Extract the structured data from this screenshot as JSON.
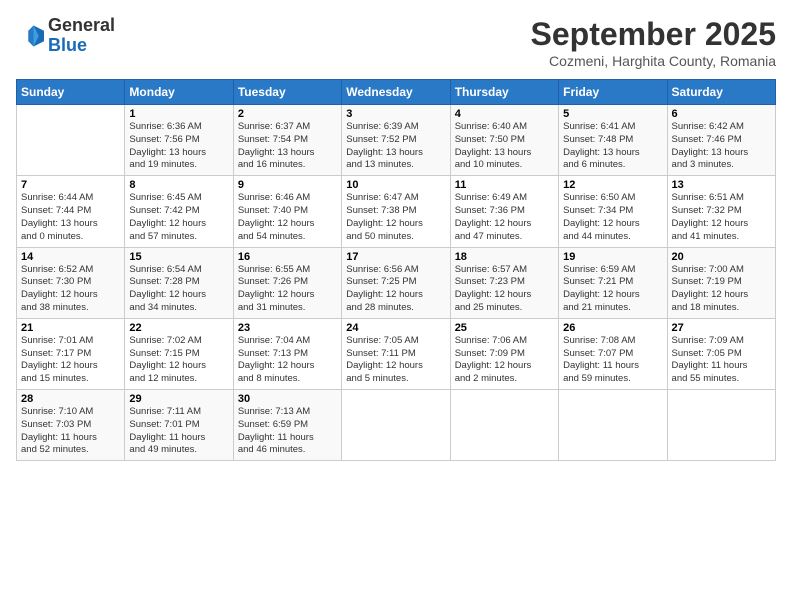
{
  "logo": {
    "line1": "General",
    "line2": "Blue"
  },
  "title": "September 2025",
  "subtitle": "Cozmeni, Harghita County, Romania",
  "weekdays": [
    "Sunday",
    "Monday",
    "Tuesday",
    "Wednesday",
    "Thursday",
    "Friday",
    "Saturday"
  ],
  "weeks": [
    [
      {
        "day": "",
        "info": ""
      },
      {
        "day": "1",
        "info": "Sunrise: 6:36 AM\nSunset: 7:56 PM\nDaylight: 13 hours\nand 19 minutes."
      },
      {
        "day": "2",
        "info": "Sunrise: 6:37 AM\nSunset: 7:54 PM\nDaylight: 13 hours\nand 16 minutes."
      },
      {
        "day": "3",
        "info": "Sunrise: 6:39 AM\nSunset: 7:52 PM\nDaylight: 13 hours\nand 13 minutes."
      },
      {
        "day": "4",
        "info": "Sunrise: 6:40 AM\nSunset: 7:50 PM\nDaylight: 13 hours\nand 10 minutes."
      },
      {
        "day": "5",
        "info": "Sunrise: 6:41 AM\nSunset: 7:48 PM\nDaylight: 13 hours\nand 6 minutes."
      },
      {
        "day": "6",
        "info": "Sunrise: 6:42 AM\nSunset: 7:46 PM\nDaylight: 13 hours\nand 3 minutes."
      }
    ],
    [
      {
        "day": "7",
        "info": "Sunrise: 6:44 AM\nSunset: 7:44 PM\nDaylight: 13 hours\nand 0 minutes."
      },
      {
        "day": "8",
        "info": "Sunrise: 6:45 AM\nSunset: 7:42 PM\nDaylight: 12 hours\nand 57 minutes."
      },
      {
        "day": "9",
        "info": "Sunrise: 6:46 AM\nSunset: 7:40 PM\nDaylight: 12 hours\nand 54 minutes."
      },
      {
        "day": "10",
        "info": "Sunrise: 6:47 AM\nSunset: 7:38 PM\nDaylight: 12 hours\nand 50 minutes."
      },
      {
        "day": "11",
        "info": "Sunrise: 6:49 AM\nSunset: 7:36 PM\nDaylight: 12 hours\nand 47 minutes."
      },
      {
        "day": "12",
        "info": "Sunrise: 6:50 AM\nSunset: 7:34 PM\nDaylight: 12 hours\nand 44 minutes."
      },
      {
        "day": "13",
        "info": "Sunrise: 6:51 AM\nSunset: 7:32 PM\nDaylight: 12 hours\nand 41 minutes."
      }
    ],
    [
      {
        "day": "14",
        "info": "Sunrise: 6:52 AM\nSunset: 7:30 PM\nDaylight: 12 hours\nand 38 minutes."
      },
      {
        "day": "15",
        "info": "Sunrise: 6:54 AM\nSunset: 7:28 PM\nDaylight: 12 hours\nand 34 minutes."
      },
      {
        "day": "16",
        "info": "Sunrise: 6:55 AM\nSunset: 7:26 PM\nDaylight: 12 hours\nand 31 minutes."
      },
      {
        "day": "17",
        "info": "Sunrise: 6:56 AM\nSunset: 7:25 PM\nDaylight: 12 hours\nand 28 minutes."
      },
      {
        "day": "18",
        "info": "Sunrise: 6:57 AM\nSunset: 7:23 PM\nDaylight: 12 hours\nand 25 minutes."
      },
      {
        "day": "19",
        "info": "Sunrise: 6:59 AM\nSunset: 7:21 PM\nDaylight: 12 hours\nand 21 minutes."
      },
      {
        "day": "20",
        "info": "Sunrise: 7:00 AM\nSunset: 7:19 PM\nDaylight: 12 hours\nand 18 minutes."
      }
    ],
    [
      {
        "day": "21",
        "info": "Sunrise: 7:01 AM\nSunset: 7:17 PM\nDaylight: 12 hours\nand 15 minutes."
      },
      {
        "day": "22",
        "info": "Sunrise: 7:02 AM\nSunset: 7:15 PM\nDaylight: 12 hours\nand 12 minutes."
      },
      {
        "day": "23",
        "info": "Sunrise: 7:04 AM\nSunset: 7:13 PM\nDaylight: 12 hours\nand 8 minutes."
      },
      {
        "day": "24",
        "info": "Sunrise: 7:05 AM\nSunset: 7:11 PM\nDaylight: 12 hours\nand 5 minutes."
      },
      {
        "day": "25",
        "info": "Sunrise: 7:06 AM\nSunset: 7:09 PM\nDaylight: 12 hours\nand 2 minutes."
      },
      {
        "day": "26",
        "info": "Sunrise: 7:08 AM\nSunset: 7:07 PM\nDaylight: 11 hours\nand 59 minutes."
      },
      {
        "day": "27",
        "info": "Sunrise: 7:09 AM\nSunset: 7:05 PM\nDaylight: 11 hours\nand 55 minutes."
      }
    ],
    [
      {
        "day": "28",
        "info": "Sunrise: 7:10 AM\nSunset: 7:03 PM\nDaylight: 11 hours\nand 52 minutes."
      },
      {
        "day": "29",
        "info": "Sunrise: 7:11 AM\nSunset: 7:01 PM\nDaylight: 11 hours\nand 49 minutes."
      },
      {
        "day": "30",
        "info": "Sunrise: 7:13 AM\nSunset: 6:59 PM\nDaylight: 11 hours\nand 46 minutes."
      },
      {
        "day": "",
        "info": ""
      },
      {
        "day": "",
        "info": ""
      },
      {
        "day": "",
        "info": ""
      },
      {
        "day": "",
        "info": ""
      }
    ]
  ]
}
